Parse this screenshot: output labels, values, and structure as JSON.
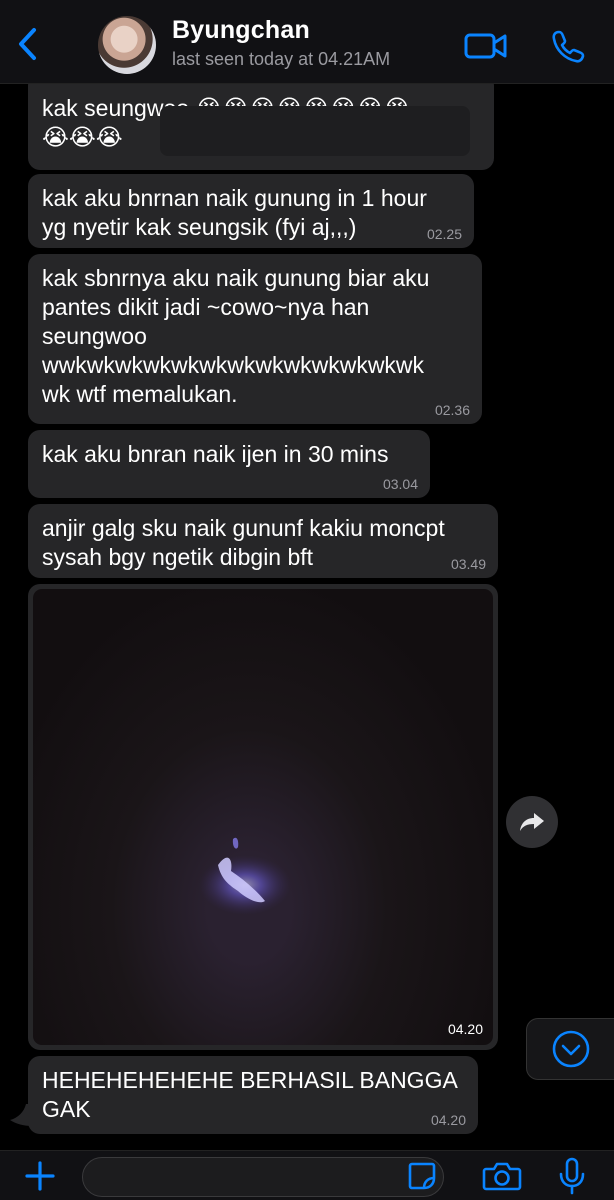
{
  "header": {
    "contact_name": "Byungchan",
    "status": "last seen today at 04.21AM",
    "icons": [
      "back-chevron-icon",
      "video-call-icon",
      "phone-call-icon"
    ],
    "accent_color": "#0a84ff"
  },
  "messages": [
    {
      "text": "kak seungwoo 😭😭😭😭😭😭😭😭\n😭😭😭",
      "time": ""
    },
    {
      "text": "kak aku bnrnan naik gunung in 1 hour\nyg nyetir kak seungsik (fyi aj,,,)",
      "time": "02.25"
    },
    {
      "text": "kak sbnrnya aku naik gunung biar aku\npantes dikit jadi ~cowo~nya han\nseungwoo\nwwkwkwkwkwkwkwkwkwkwkwkwkwk\nwk wtf memalukan.",
      "time": "02.36"
    },
    {
      "text": "kak aku bnran naik ijen in 30 mins",
      "time": "03.04"
    },
    {
      "text": "anjir galg sku naik gununf kakiu moncpt\nsysah bgy ngetik dibgin bft",
      "time": "03.49"
    },
    {
      "text": "",
      "time": "04.20"
    },
    {
      "text": "HEHEHEHEHEHE BERHASIL BANGGA\nGAK",
      "time": "04.20"
    }
  ],
  "composer": {
    "input_value": "",
    "input_placeholder": ""
  },
  "colors": {
    "bubble": "#262628",
    "background": "#000000",
    "meta_text": "#9a9aa0"
  }
}
